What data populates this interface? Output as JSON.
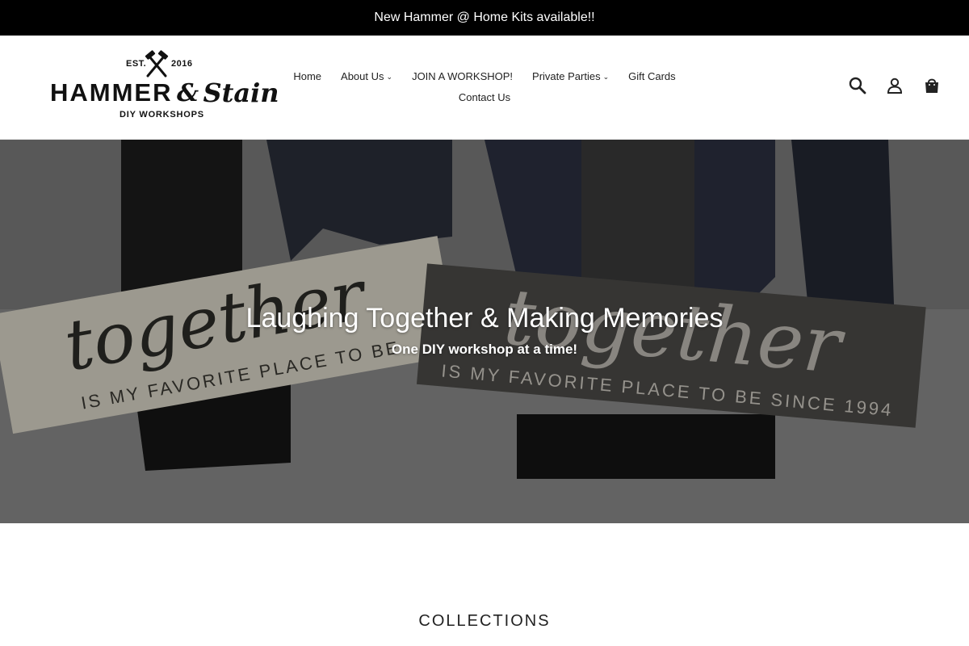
{
  "announcement": {
    "text": "New Hammer @ Home Kits available!!"
  },
  "logo": {
    "est": "EST.",
    "year": "2016",
    "name_part1": "HAMMER",
    "ampersand": "&",
    "name_part2": "Stain",
    "subtitle": "DIY WORKSHOPS"
  },
  "nav": {
    "items": [
      {
        "label": "Home"
      },
      {
        "label": "About Us",
        "dropdown": true
      },
      {
        "label": "JOIN A WORKSHOP!"
      },
      {
        "label": "Private Parties",
        "dropdown": true
      },
      {
        "label": "Gift Cards"
      },
      {
        "label": "Contact Us"
      }
    ]
  },
  "header_icons": [
    "search-icon",
    "account-icon",
    "cart-icon"
  ],
  "hero": {
    "title": "Laughing Together & Making Memories",
    "subtitle": "One DIY workshop at a time!",
    "sign_left": {
      "script": "together",
      "line": "IS MY FAVORITE PLACE TO BE"
    },
    "sign_right": {
      "script": "together",
      "line": "IS MY FAVORITE PLACE TO BE SINCE 1994"
    }
  },
  "collections": {
    "heading": "COLLECTIONS"
  },
  "colors": {
    "announcement_bg": "#000000",
    "text": "#222222",
    "hero_text": "#ffffff"
  }
}
